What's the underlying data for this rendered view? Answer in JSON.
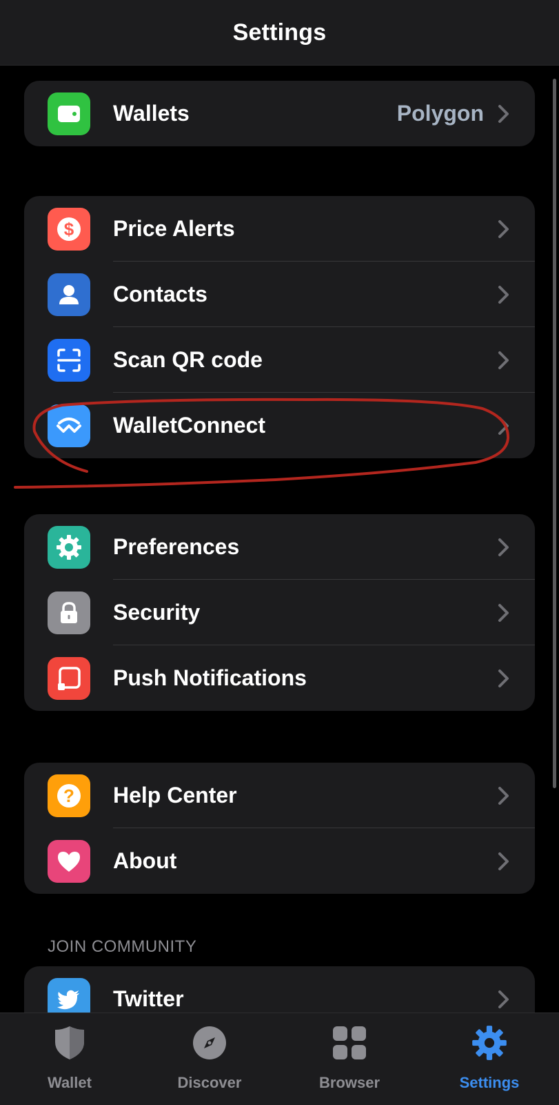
{
  "header": {
    "title": "Settings"
  },
  "groups": {
    "g1": [
      {
        "label": "Wallets",
        "value": "Polygon",
        "icon": "wallet-icon",
        "color": "#30c241"
      }
    ],
    "g2": [
      {
        "label": "Price Alerts",
        "icon": "dollar-icon",
        "color": "#ff5b4f"
      },
      {
        "label": "Contacts",
        "icon": "person-icon",
        "color": "#2f6fd0"
      },
      {
        "label": "Scan QR code",
        "icon": "scan-icon",
        "color": "#1f6ef1"
      },
      {
        "label": "WalletConnect",
        "icon": "walletconnect-icon",
        "color": "#3b99fc"
      }
    ],
    "g3": [
      {
        "label": "Preferences",
        "icon": "gear-icon",
        "color": "#2ab59a"
      },
      {
        "label": "Security",
        "icon": "lock-icon",
        "color": "#8e8e93"
      },
      {
        "label": "Push Notifications",
        "icon": "notification-icon",
        "color": "#f1463c"
      }
    ],
    "g4": [
      {
        "label": "Help Center",
        "icon": "question-icon",
        "color": "#ff9f0a"
      },
      {
        "label": "About",
        "icon": "heart-icon",
        "color": "#e8457a"
      }
    ],
    "community_header": "JOIN COMMUNITY",
    "community": [
      {
        "label": "Twitter",
        "icon": "twitter-icon",
        "color": "#3a9be8"
      }
    ]
  },
  "tabbar": {
    "items": [
      {
        "label": "Wallet",
        "icon": "shield-icon",
        "active": false
      },
      {
        "label": "Discover",
        "icon": "compass-icon",
        "active": false
      },
      {
        "label": "Browser",
        "icon": "grid-icon",
        "active": false
      },
      {
        "label": "Settings",
        "icon": "gear-icon",
        "active": true
      }
    ],
    "active_color": "#3c8ef0",
    "inactive_color": "#8e8e93"
  },
  "annotation": {
    "color": "#b3261e",
    "target": "WalletConnect"
  }
}
